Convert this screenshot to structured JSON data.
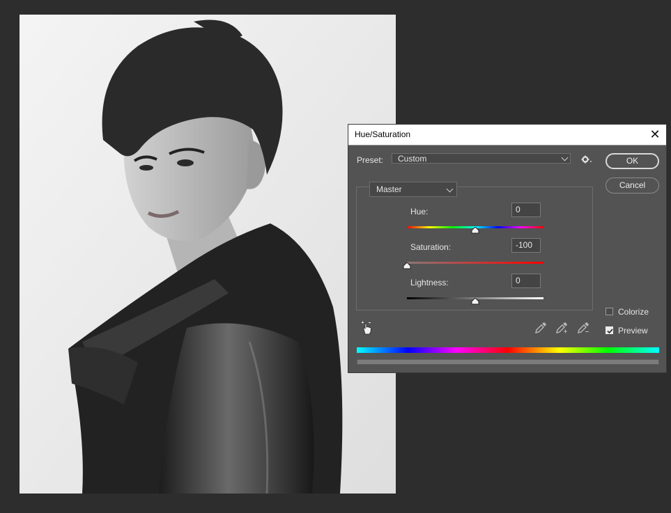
{
  "dialog": {
    "title": "Hue/Saturation",
    "preset_label": "Preset:",
    "preset_value": "Custom",
    "channel_value": "Master",
    "ok_label": "OK",
    "cancel_label": "Cancel",
    "hue": {
      "label": "Hue:",
      "value": "0",
      "min": -180,
      "max": 180
    },
    "saturation": {
      "label": "Saturation:",
      "value": "-100",
      "min": -100,
      "max": 100
    },
    "lightness": {
      "label": "Lightness:",
      "value": "0",
      "min": -100,
      "max": 100
    },
    "colorize": {
      "label": "Colorize",
      "checked": false
    },
    "preview": {
      "label": "Preview",
      "checked": true
    }
  },
  "icons": {
    "close": "close-icon",
    "gear": "gear-icon",
    "hand": "targeted-adjustment-icon",
    "eyedropper": "eyedropper-icon",
    "eyedropper_plus": "eyedropper-plus-icon",
    "eyedropper_minus": "eyedropper-minus-icon"
  },
  "colors": {
    "dialog_bg": "#535353",
    "canvas_bg": "#2d2d2d",
    "titlebar_bg": "#ffffff"
  }
}
